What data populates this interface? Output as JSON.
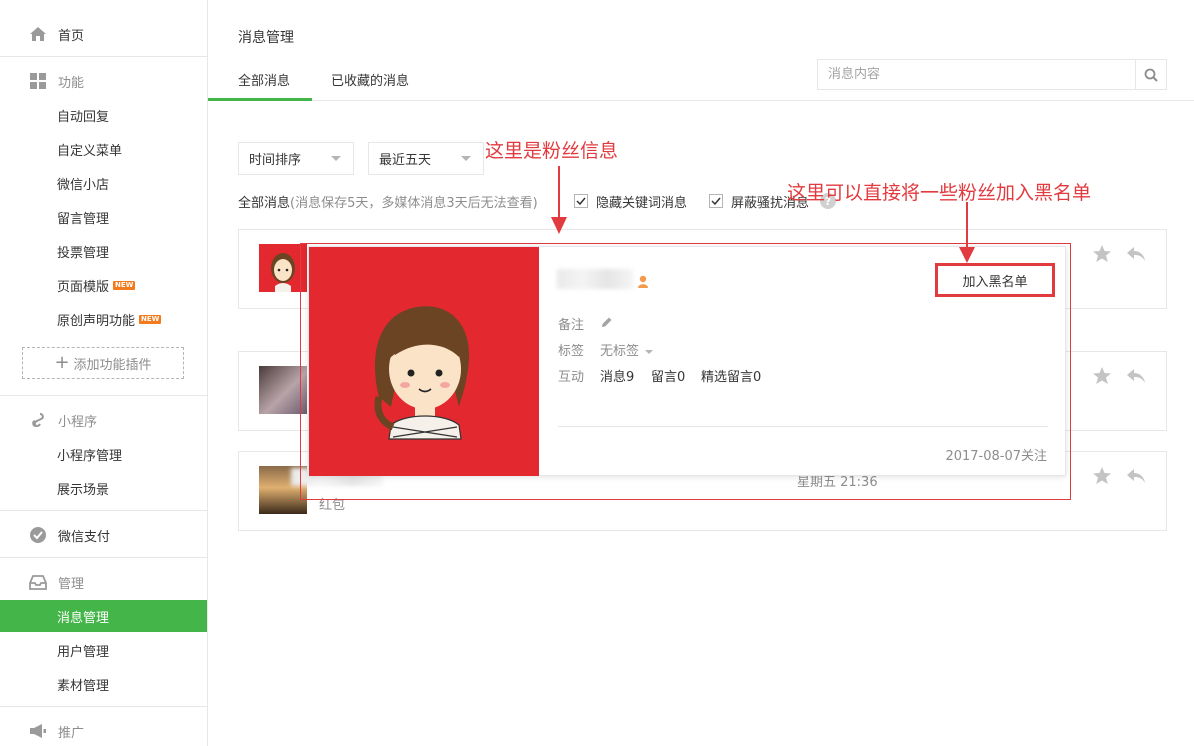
{
  "sidebar": {
    "home": "首页",
    "functions": {
      "title": "功能",
      "items": [
        "自动回复",
        "自定义菜单",
        "微信小店",
        "留言管理",
        "投票管理",
        "页面模版",
        "原创声明功能"
      ],
      "new_badge": "NEW",
      "add_plugin": "添加功能插件"
    },
    "miniprogram": {
      "title": "小程序",
      "items": [
        "小程序管理",
        "展示场景"
      ]
    },
    "wechat_pay": "微信支付",
    "manage": {
      "title": "管理",
      "items": [
        "消息管理",
        "用户管理",
        "素材管理"
      ]
    },
    "promote": "推广"
  },
  "main": {
    "title": "消息管理",
    "tabs": [
      "全部消息",
      "已收藏的消息"
    ],
    "search": {
      "placeholder": "消息内容"
    },
    "sort_select": "时间排序",
    "range_select": "最近五天",
    "filter_all": "全部消息",
    "filter_hint": "(消息保存5天，多媒体消息3天后无法查看)",
    "checkbox_hide_keyword": "隐藏关键词消息",
    "checkbox_block_spam": "屏蔽骚扰消息",
    "help": "?"
  },
  "messages": [
    {
      "time": "",
      "text": ""
    },
    {
      "time": "",
      "text": ""
    },
    {
      "time": "星期五 21:36",
      "text": "红包"
    }
  ],
  "popup": {
    "remark_label": "备注",
    "tag_label": "标签",
    "tag_value": "无标签",
    "interact_label": "互动",
    "stat_messages": "消息9",
    "stat_comments": "留言0",
    "stat_featured": "精选留言0",
    "blacklist_button": "加入黑名单",
    "follow_date": "2017-08-07关注"
  },
  "annotations": {
    "fan_info": "这里是粉丝信息",
    "blacklist_tip": "这里可以直接将一些粉丝加入黑名单"
  },
  "colors": {
    "accent_green": "#44b549",
    "annotation_red": "#e23b3f",
    "avatar_red": "#e4282f"
  }
}
